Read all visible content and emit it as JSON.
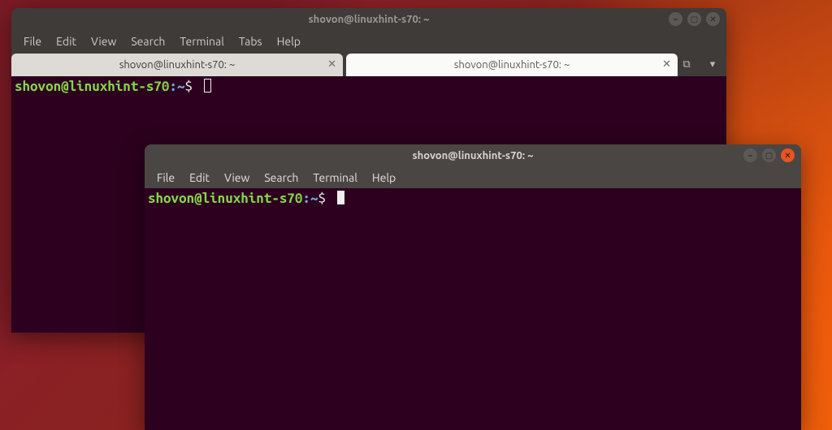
{
  "window1": {
    "title": "shovon@linuxhint-s70: ~",
    "menu": {
      "file": "File",
      "edit": "Edit",
      "view": "View",
      "search": "Search",
      "terminal": "Terminal",
      "tabs": "Tabs",
      "help": "Help"
    },
    "tabs": [
      {
        "label": "shovon@linuxhint-s70: ~"
      },
      {
        "label": "shovon@linuxhint-s70: ~"
      }
    ],
    "prompt": {
      "userhost": "shovon@linuxhint-s70",
      "sep": ":",
      "path": "~",
      "sym": "$"
    }
  },
  "window2": {
    "title": "shovon@linuxhint-s70: ~",
    "menu": {
      "file": "File",
      "edit": "Edit",
      "view": "View",
      "search": "Search",
      "terminal": "Terminal",
      "help": "Help"
    },
    "prompt": {
      "userhost": "shovon@linuxhint-s70",
      "sep": ":",
      "path": "~",
      "sym": "$"
    }
  },
  "glyphs": {
    "close": "✕",
    "min": "–",
    "max": "▢",
    "new": "⧉",
    "down": "▾"
  }
}
